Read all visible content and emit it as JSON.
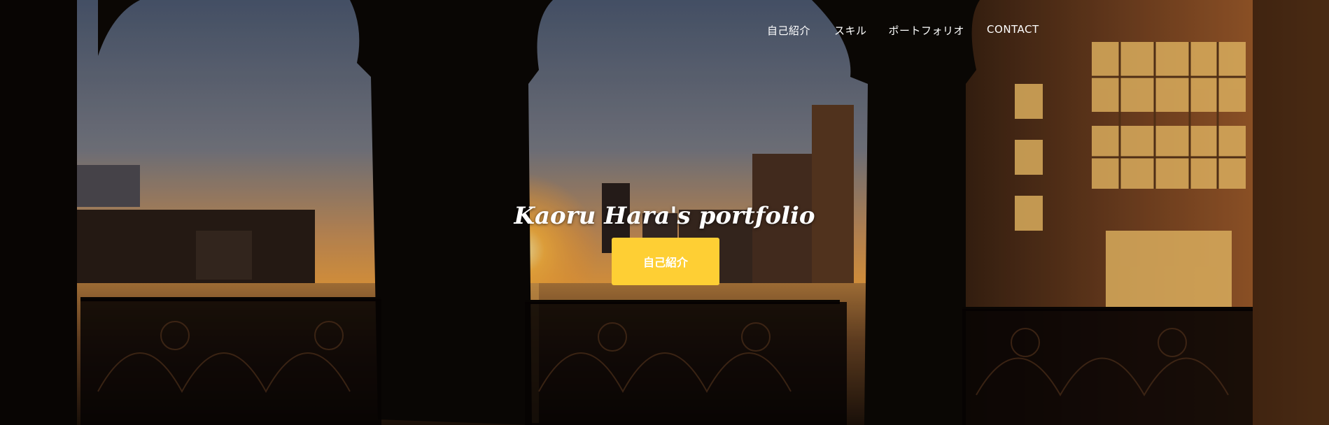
{
  "nav": {
    "items": [
      "自己紹介",
      "スキル",
      "ポートフォリオ",
      "CONTACT"
    ]
  },
  "hero": {
    "title": "Kaoru Hara's portfolio",
    "button_label": "自己紹介",
    "button_color": "#fecf34",
    "background": "photo of river at sunset viewed through brick arches and ornate iron railing"
  }
}
